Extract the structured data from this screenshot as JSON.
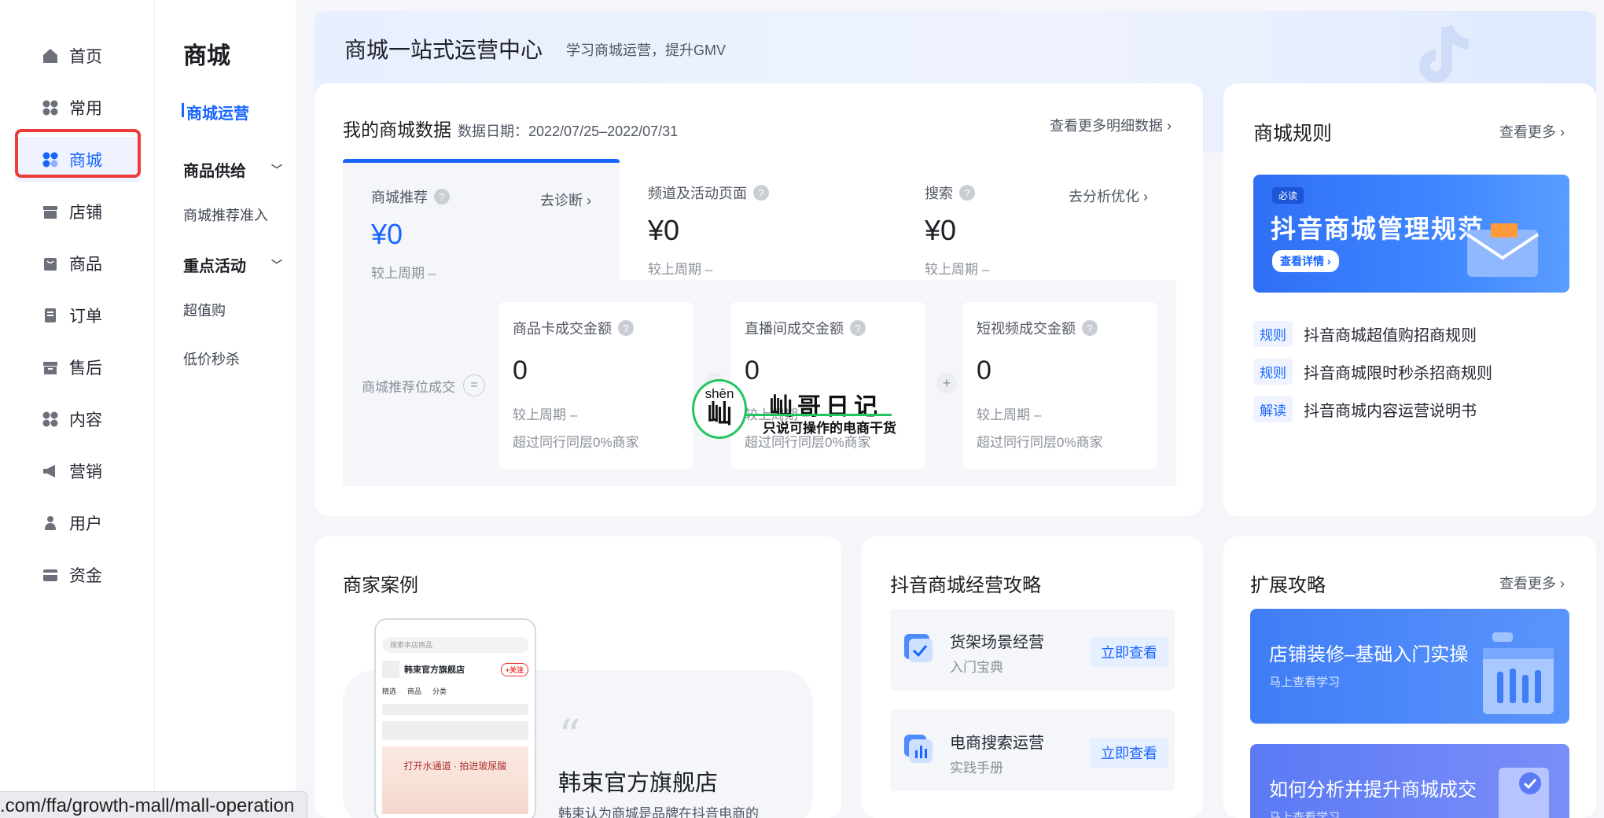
{
  "nav": {
    "items": [
      {
        "label": "首页",
        "icon": "home-icon"
      },
      {
        "label": "常用",
        "icon": "grid-icon"
      },
      {
        "label": "商城",
        "icon": "mall-icon",
        "active": true
      },
      {
        "label": "店铺",
        "icon": "store-icon"
      },
      {
        "label": "商品",
        "icon": "bag-icon"
      },
      {
        "label": "订单",
        "icon": "order-icon"
      },
      {
        "label": "售后",
        "icon": "aftersale-icon"
      },
      {
        "label": "内容",
        "icon": "content-icon"
      },
      {
        "label": "营销",
        "icon": "megaphone-icon"
      },
      {
        "label": "用户",
        "icon": "user-icon"
      },
      {
        "label": "资金",
        "icon": "wallet-icon"
      }
    ]
  },
  "subnav": {
    "title": "商城",
    "active": "商城运营",
    "group1": "商品供给",
    "group1_items": [
      "商城推荐准入"
    ],
    "group2": "重点活动",
    "group2_items": [
      "超值购",
      "低价秒杀"
    ]
  },
  "banner": {
    "title": "商城一站式运营中心",
    "subtitle": "学习商城运营，提升GMV"
  },
  "data_card": {
    "title": "我的商城数据",
    "date": "数据日期：2022/07/25–2022/07/31",
    "more": "查看更多明细数据 ›",
    "tabs": [
      {
        "label": "商城推荐",
        "action": "去诊断 ›",
        "value": "¥0",
        "compare": "较上周期 –"
      },
      {
        "label": "频道及活动页面",
        "action": "",
        "value": "¥0",
        "compare": "较上周期 –"
      },
      {
        "label": "搜索",
        "action": "去分析优化 ›",
        "value": "¥0",
        "compare": "较上周期 –"
      }
    ],
    "bottom_label": "商城推荐位成交",
    "metrics": [
      {
        "label": "商品卡成交金额",
        "value": "0",
        "compare": "较上周期 –",
        "peer": "超过同行同层0%商家"
      },
      {
        "label": "直播间成交金额",
        "value": "0",
        "compare": "较上周期 –",
        "peer": "超过同行同层0%商家"
      },
      {
        "label": "短视频成交金额",
        "value": "0",
        "compare": "较上周期 –",
        "peer": "超过同行同层0%商家"
      }
    ]
  },
  "watermark": {
    "pinyin": "shēn",
    "char": "屾",
    "name": "屾哥日记",
    "slogan": "只说可操作的电商干货"
  },
  "rules_card": {
    "title": "商城规则",
    "more": "查看更多 ›",
    "banner_tag": "必读",
    "banner_title": "抖音商城管理规范",
    "banner_btn": "查看详情 ›",
    "items": [
      {
        "tag": "规则",
        "text": "抖音商城超值购招商规则"
      },
      {
        "tag": "规则",
        "text": "抖音商城限时秒杀招商规则"
      },
      {
        "tag": "解读",
        "text": "抖音商城内容运营说明书"
      }
    ]
  },
  "cases_card": {
    "title": "商家案例",
    "store_name": "韩束官方旗舰店",
    "desc": "韩束认为商城是品牌在抖音电商的",
    "phone": {
      "search": "搜索本店商品",
      "store": "韩束官方旗舰店",
      "follow": "+关注",
      "tabs": [
        "精选",
        "商品",
        "分类"
      ],
      "promo": "打开水通道 · 拍进玻尿酸"
    }
  },
  "strategy_card": {
    "title": "抖音商城经营攻略",
    "items": [
      {
        "title": "货架场景经营",
        "sub": "入门宝典",
        "btn": "立即查看"
      },
      {
        "title": "电商搜索运营",
        "sub": "实践手册",
        "btn": "立即查看"
      }
    ]
  },
  "expand_card": {
    "title": "扩展攻略",
    "more": "查看更多 ›",
    "items": [
      {
        "title": "店铺装修–基础入门实操",
        "sub": "马上查看学习"
      },
      {
        "title": "如何分析并提升商城成交",
        "sub": "马上查看学习"
      }
    ]
  },
  "statusbar": {
    "url": ".com/ffa/growth-mall/mall-operation"
  },
  "colors": {
    "accent": "#1966ff",
    "highlight": "#ef3a3a",
    "watermark": "#22c55e"
  }
}
